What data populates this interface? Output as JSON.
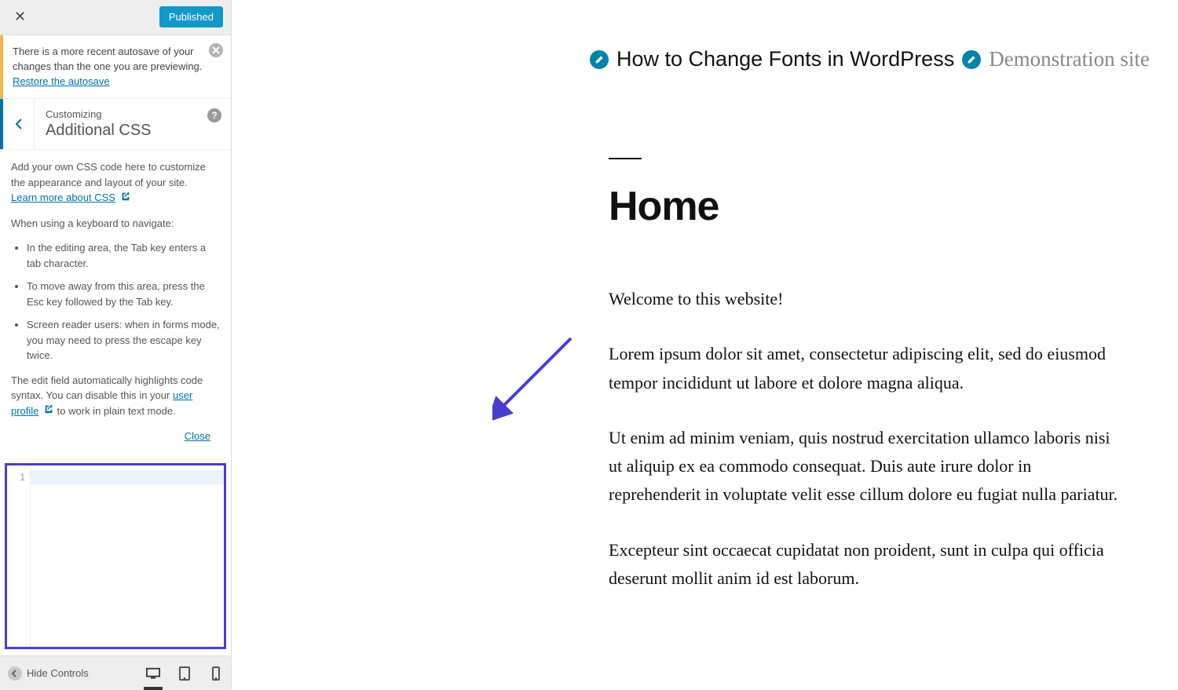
{
  "sidebar": {
    "published_label": "Published",
    "autosave": {
      "text": "There is a more recent autosave of your changes than the one you are previewing. ",
      "link": "Restore the autosave"
    },
    "header": {
      "kicker": "Customizing",
      "title": "Additional CSS"
    },
    "instructions": {
      "intro": "Add your own CSS code here to customize the appearance and layout of your site.",
      "learn_more": "Learn more about CSS",
      "kb_heading": "When using a keyboard to navigate:",
      "bullets": [
        "In the editing area, the Tab key enters a tab character.",
        "To move away from this area, press the Esc key followed by the Tab key.",
        "Screen reader users: when in forms mode, you may need to press the escape key twice."
      ],
      "syntax1": "The edit field automatically highlights code syntax. You can disable this in your ",
      "user_profile_link": "user profile",
      "syntax2": " to work in plain text mode.",
      "close": "Close"
    },
    "editor": {
      "first_line_number": "1"
    },
    "footer": {
      "hide_controls": "Hide Controls"
    }
  },
  "preview": {
    "site_title": "How to Change Fonts in WordPress",
    "site_tag": "Demonstration site",
    "page_title": "Home",
    "paragraphs": [
      "Welcome to this website!",
      "Lorem ipsum dolor sit amet, consectetur adipiscing elit, sed do eiusmod tempor incididunt ut labore et dolore magna aliqua.",
      "Ut enim ad minim veniam, quis nostrud exercitation ullamco laboris nisi ut aliquip ex ea commodo consequat. Duis aute irure dolor in reprehenderit in voluptate velit esse cillum dolore eu fugiat nulla pariatur.",
      "Excepteur sint occaecat cupidatat non proident, sunt in culpa qui officia deserunt mollit anim id est laborum."
    ]
  }
}
